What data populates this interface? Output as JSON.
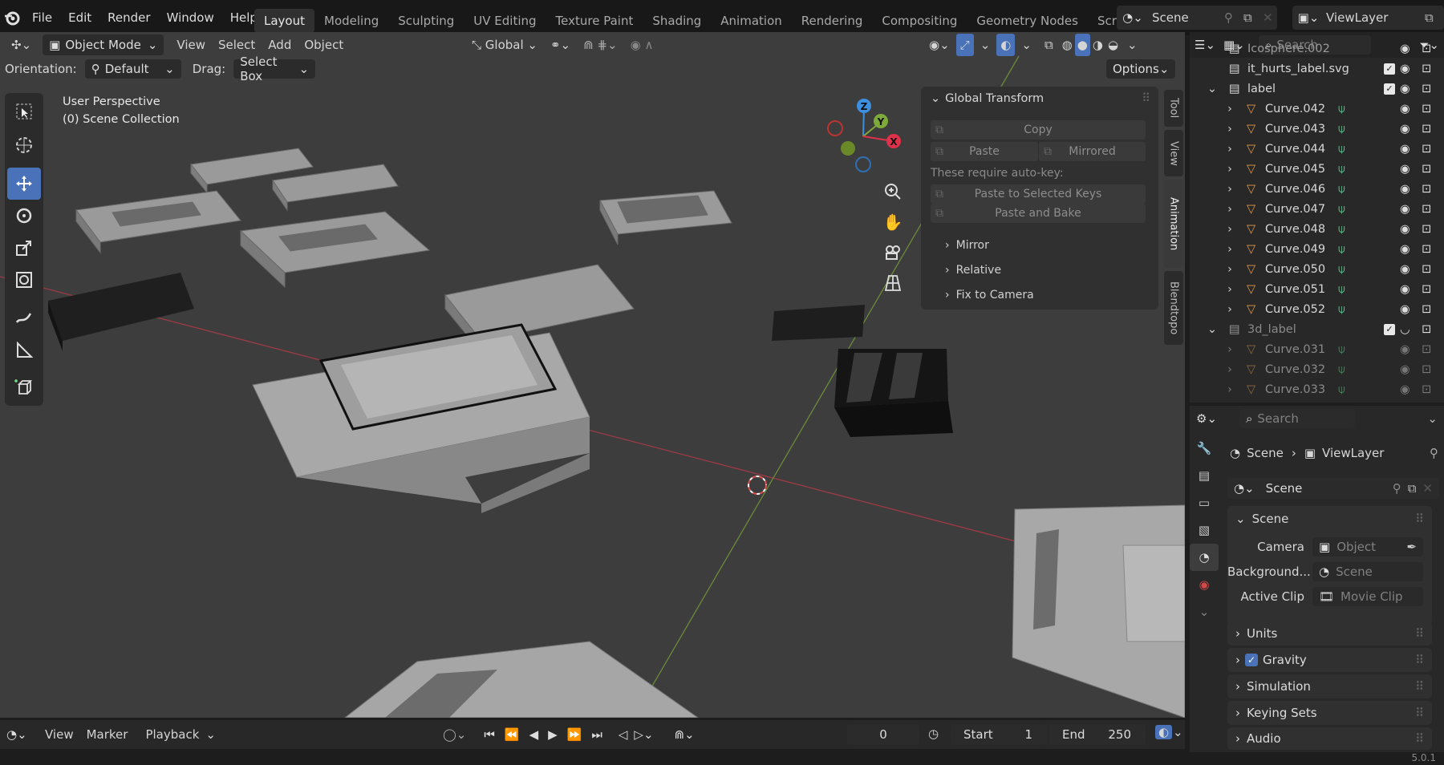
{
  "menubar": {
    "items": [
      "File",
      "Edit",
      "Render",
      "Window",
      "Help"
    ],
    "workspaces": [
      "Layout",
      "Modeling",
      "Sculpting",
      "UV Editing",
      "Texture Paint",
      "Shading",
      "Animation",
      "Rendering",
      "Compositing",
      "Geometry Nodes",
      "Scripting"
    ],
    "active_workspace": "Layout",
    "scene_name": "Scene",
    "view_layer": "ViewLayer"
  },
  "viewport_header": {
    "mode": "Object Mode",
    "menus": [
      "View",
      "Select",
      "Add",
      "Object"
    ],
    "transform_orientation": "Global"
  },
  "tool_settings": {
    "orientation_label": "Orientation:",
    "orientation_value": "Default",
    "drag_label": "Drag:",
    "drag_value": "Select Box",
    "options_label": "Options"
  },
  "viewport": {
    "view_name": "User Perspective",
    "collection": "(0) Scene Collection",
    "gizmo_axes": [
      "Z",
      "Y",
      "X"
    ]
  },
  "npanel": {
    "header": "Global Transform",
    "copy": "Copy",
    "paste": "Paste",
    "mirrored": "Mirrored",
    "note": "These require auto-key:",
    "paste_selected": "Paste to Selected Keys",
    "paste_bake": "Paste and Bake",
    "subpanels": [
      "Mirror",
      "Relative",
      "Fix to Camera"
    ],
    "tabs": [
      "Tool",
      "View",
      "Animation",
      "Blendtopo"
    ],
    "active_tab": "Animation"
  },
  "outliner": {
    "search_placeholder": "Search",
    "rows": [
      {
        "name": "Icosphere.002",
        "kind": "partial"
      },
      {
        "name": "it_hurts_label.svg",
        "kind": "collection"
      },
      {
        "name": "label",
        "kind": "collection"
      },
      {
        "name": "Curve.042",
        "kind": "curve"
      },
      {
        "name": "Curve.043",
        "kind": "curve"
      },
      {
        "name": "Curve.044",
        "kind": "curve"
      },
      {
        "name": "Curve.045",
        "kind": "curve"
      },
      {
        "name": "Curve.046",
        "kind": "curve"
      },
      {
        "name": "Curve.047",
        "kind": "curve"
      },
      {
        "name": "Curve.048",
        "kind": "curve"
      },
      {
        "name": "Curve.049",
        "kind": "curve"
      },
      {
        "name": "Curve.050",
        "kind": "curve"
      },
      {
        "name": "Curve.051",
        "kind": "curve"
      },
      {
        "name": "Curve.052",
        "kind": "curve"
      },
      {
        "name": "3d_label",
        "kind": "collection"
      },
      {
        "name": "Curve.031",
        "kind": "curve-dim"
      },
      {
        "name": "Curve.032",
        "kind": "curve-dim"
      },
      {
        "name": "Curve.033",
        "kind": "curve-dim"
      }
    ]
  },
  "properties": {
    "search_placeholder": "Search",
    "breadcrumb_scene": "Scene",
    "breadcrumb_viewlayer": "ViewLayer",
    "scene_field": "Scene",
    "panel_scene": "Scene",
    "camera_label": "Camera",
    "camera_value": "Object",
    "background_label": "Background...",
    "background_value": "Scene",
    "clip_label": "Active Clip",
    "clip_value": "Movie Clip",
    "panels": [
      "Units",
      "Gravity",
      "Simulation",
      "Keying Sets",
      "Audio"
    ]
  },
  "timeline": {
    "menus": [
      "View",
      "Marker",
      "Playback"
    ],
    "current_frame": "0",
    "start_label": "Start",
    "start_value": "1",
    "end_label": "End",
    "end_value": "250"
  },
  "statusbar": {
    "version": "5.0.1"
  },
  "colors": {
    "accent": "#4a72b8",
    "x_axis": "#e0304a",
    "y_axis": "#7eaa3a",
    "z_axis": "#3d8fe0",
    "curve_icon": "#e09848",
    "data_icon": "#60c090"
  }
}
